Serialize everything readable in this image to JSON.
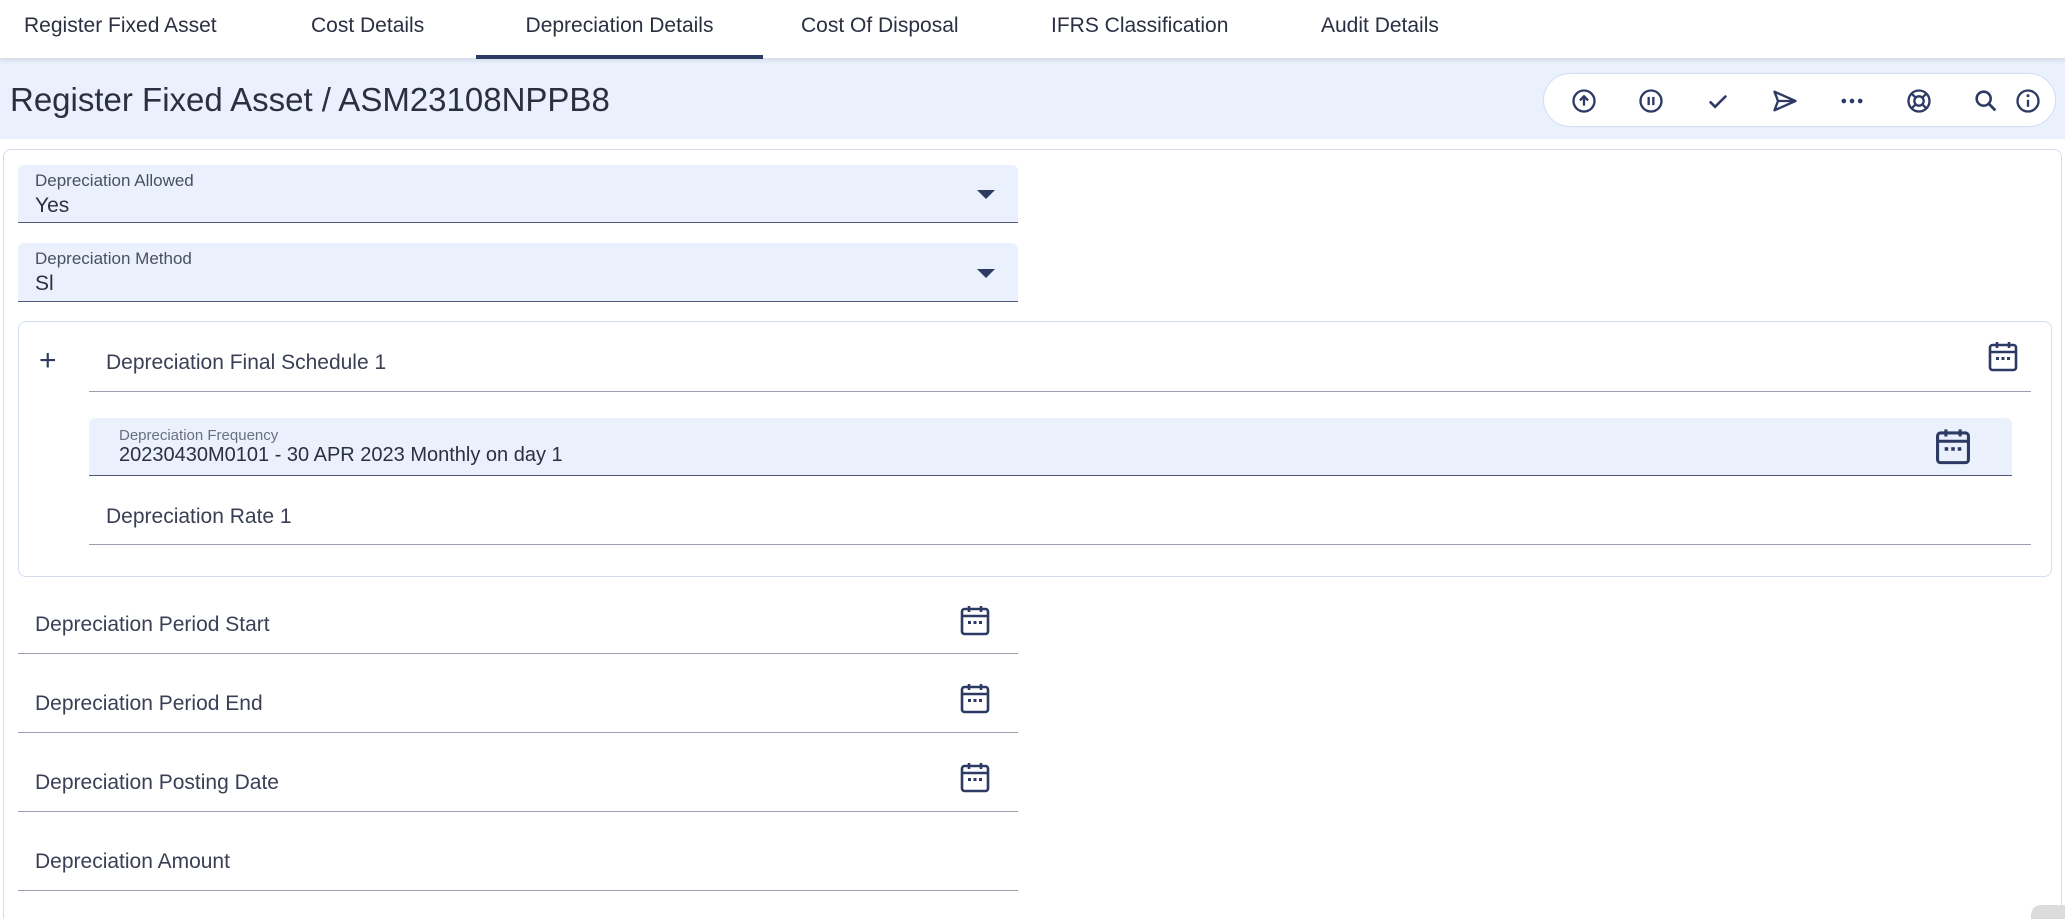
{
  "tabs": [
    {
      "label": "Register Fixed Asset",
      "active": false
    },
    {
      "label": "Cost Details",
      "active": false
    },
    {
      "label": "Depreciation Details",
      "active": true
    },
    {
      "label": "Cost Of Disposal",
      "active": false
    },
    {
      "label": "IFRS Classification",
      "active": false
    },
    {
      "label": "Audit Details",
      "active": false
    }
  ],
  "header": {
    "title": "Register Fixed Asset / ASM23108NPPB8"
  },
  "toolbar": {
    "icons": [
      "upload-circle-icon",
      "pause-circle-icon",
      "check-icon",
      "send-icon",
      "more-horizontal-icon",
      "support-lifebuoy-icon",
      "search-icon",
      "info-icon"
    ]
  },
  "form": {
    "depreciation_allowed": {
      "label": "Depreciation Allowed",
      "value": "Yes"
    },
    "depreciation_method": {
      "label": "Depreciation Method",
      "value": "Sl"
    },
    "schedule": {
      "title": "Depreciation Final Schedule 1",
      "frequency": {
        "label": "Depreciation Frequency",
        "value": "20230430M0101 - 30 APR 2023 Monthly on day 1"
      },
      "rate": {
        "placeholder": "Depreciation Rate 1"
      }
    },
    "period_start": {
      "placeholder": "Depreciation Period Start"
    },
    "period_end": {
      "placeholder": "Depreciation Period End"
    },
    "posting_date": {
      "placeholder": "Depreciation Posting Date"
    },
    "amount": {
      "placeholder": "Depreciation Amount"
    }
  },
  "colors": {
    "accent": "#2d3a64",
    "header_bg": "#eaf1fd",
    "text": "#2b2f42"
  }
}
